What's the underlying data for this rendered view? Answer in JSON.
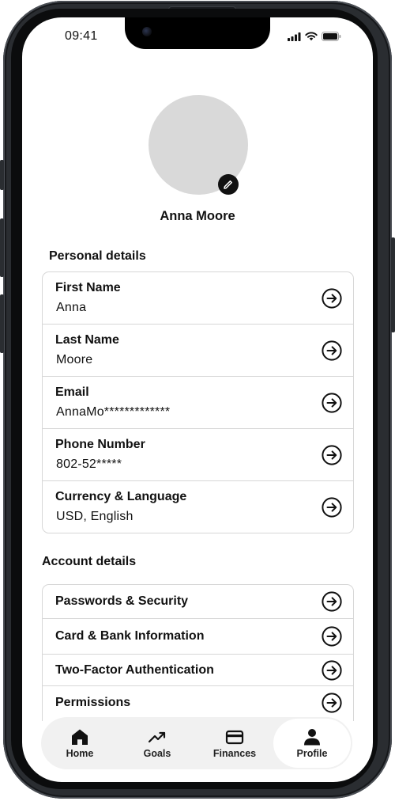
{
  "status_bar": {
    "time": "09:41"
  },
  "profile": {
    "name": "Anna Moore"
  },
  "personal_details": {
    "title": "Personal details",
    "rows": [
      {
        "label": "First Name",
        "value": "Anna"
      },
      {
        "label": "Last Name",
        "value": "Moore"
      },
      {
        "label": "Email",
        "value": "AnnaMo*************"
      },
      {
        "label": "Phone Number",
        "value": "802-52*****"
      },
      {
        "label": "Currency & Language",
        "value": "USD, English"
      }
    ]
  },
  "account_details": {
    "title": "Account details",
    "rows": [
      {
        "label": "Passwords & Security"
      },
      {
        "label": "Card & Bank Information"
      },
      {
        "label": "Two-Factor Authentication"
      },
      {
        "label": "Permissions"
      }
    ]
  },
  "tabbar": {
    "active": "Profile",
    "tabs": [
      {
        "label": "Home",
        "icon": "home-icon"
      },
      {
        "label": "Goals",
        "icon": "trending-up-icon"
      },
      {
        "label": "Finances",
        "icon": "credit-card-icon"
      },
      {
        "label": "Profile",
        "icon": "person-icon"
      }
    ]
  }
}
